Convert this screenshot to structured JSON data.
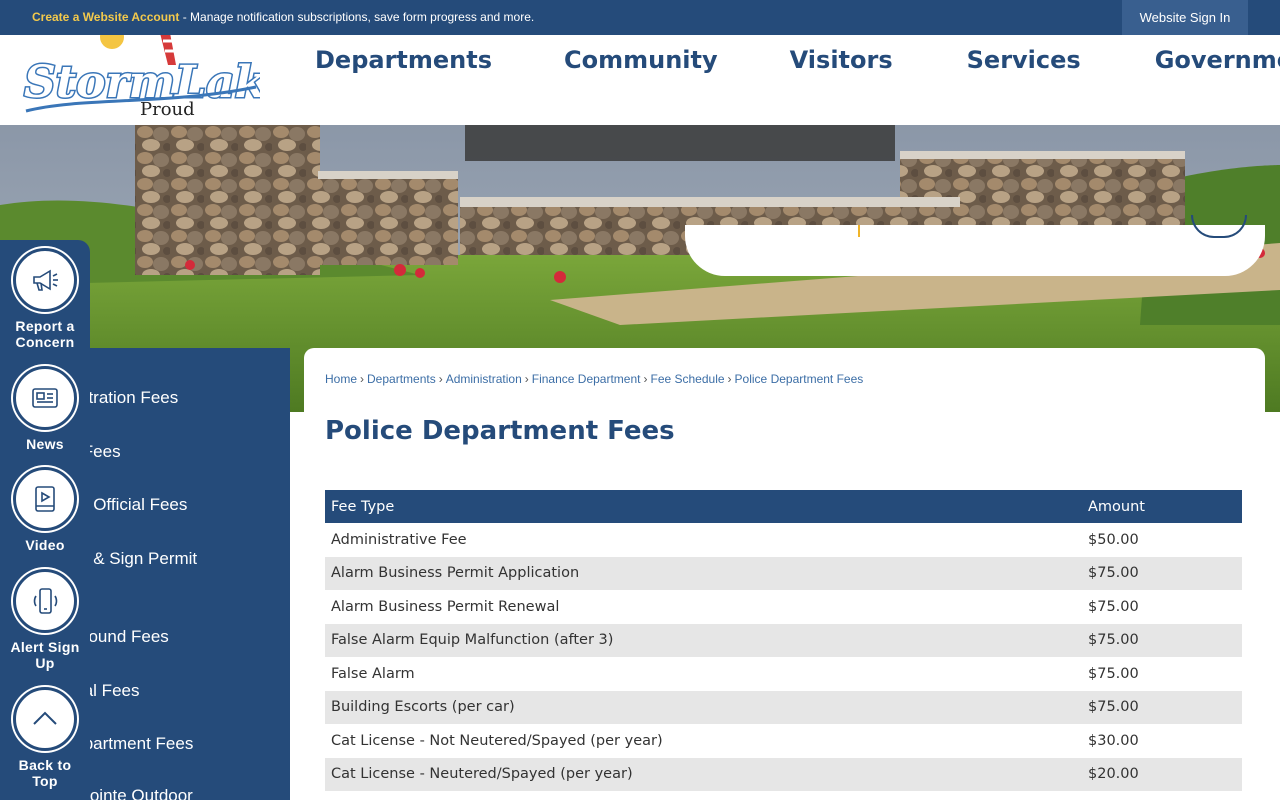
{
  "topbar": {
    "create_account": "Create a Website Account",
    "tagline": " - Manage notification subscriptions, save form progress and more.",
    "signin": "Website Sign In"
  },
  "logo": {
    "line1": "StormLake",
    "line2": "Proud"
  },
  "nav": [
    "Departments",
    "Community",
    "Visitors",
    "Services",
    "Government"
  ],
  "quick_links": [
    {
      "label_1": "Report a",
      "label_2": "Concern",
      "icon": "megaphone-icon"
    },
    {
      "label_1": "News",
      "label_2": "",
      "icon": "newspaper-icon"
    },
    {
      "label_1": "Video",
      "label_2": "",
      "icon": "video-icon"
    },
    {
      "label_1": "Alert Sign",
      "label_2": "Up",
      "icon": "phone-alert-icon"
    },
    {
      "label_1": "Back to",
      "label_2": "Top",
      "icon": "chevron-up-icon"
    }
  ],
  "subnav": [
    "Administration Fees",
    "Airport Fees",
    "Building Official Fees",
    "Building & Sign Permit",
    "",
    "Campground Fees",
    "Electrical Fees",
    "Fire Department Fees",
    "King's Pointe Outdoor"
  ],
  "breadcrumb": [
    "Home",
    "Departments",
    "Administration",
    "Finance Department",
    "Fee Schedule",
    "Police Department Fees"
  ],
  "page_title": "Police Department Fees",
  "table": {
    "headers": [
      "Fee Type",
      "Amount"
    ],
    "rows": [
      [
        "Administrative Fee",
        "$50.00"
      ],
      [
        "Alarm Business Permit Application",
        "$75.00"
      ],
      [
        "Alarm Business Permit Renewal",
        "$75.00"
      ],
      [
        "False Alarm Equip Malfunction (after 3)",
        "$75.00"
      ],
      [
        "False Alarm",
        "$75.00"
      ],
      [
        "Building Escorts (per car)",
        "$75.00"
      ],
      [
        "Cat License - Not Neutered/Spayed (per year)",
        "$30.00"
      ],
      [
        "Cat License - Neutered/Spayed (per year)",
        "$20.00"
      ]
    ]
  },
  "colors": {
    "brand_navy": "#254b7a",
    "link_blue": "#3c6ea6",
    "accent_gold": "#f2c94c"
  }
}
